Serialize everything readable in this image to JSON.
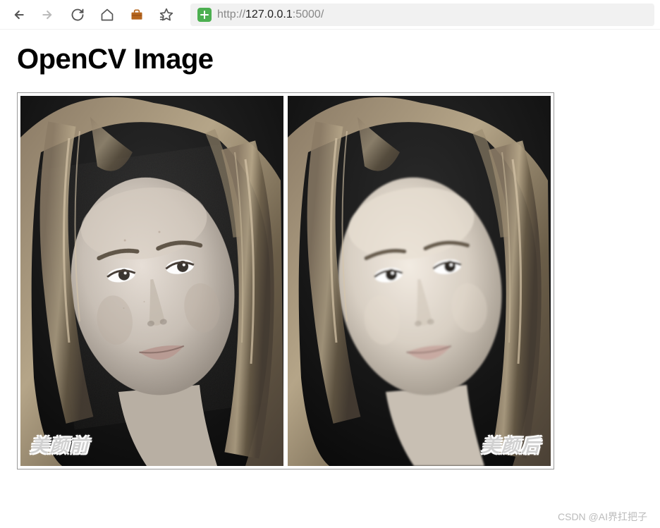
{
  "toolbar": {
    "url": {
      "protocol": "http://",
      "host": "127.0.0.1",
      "port": ":5000",
      "path": "/"
    }
  },
  "page": {
    "title": "OpenCV Image"
  },
  "images": {
    "left_label": "美颜前",
    "right_label": "美颜后"
  },
  "watermark": "CSDN @AI界扛把子"
}
